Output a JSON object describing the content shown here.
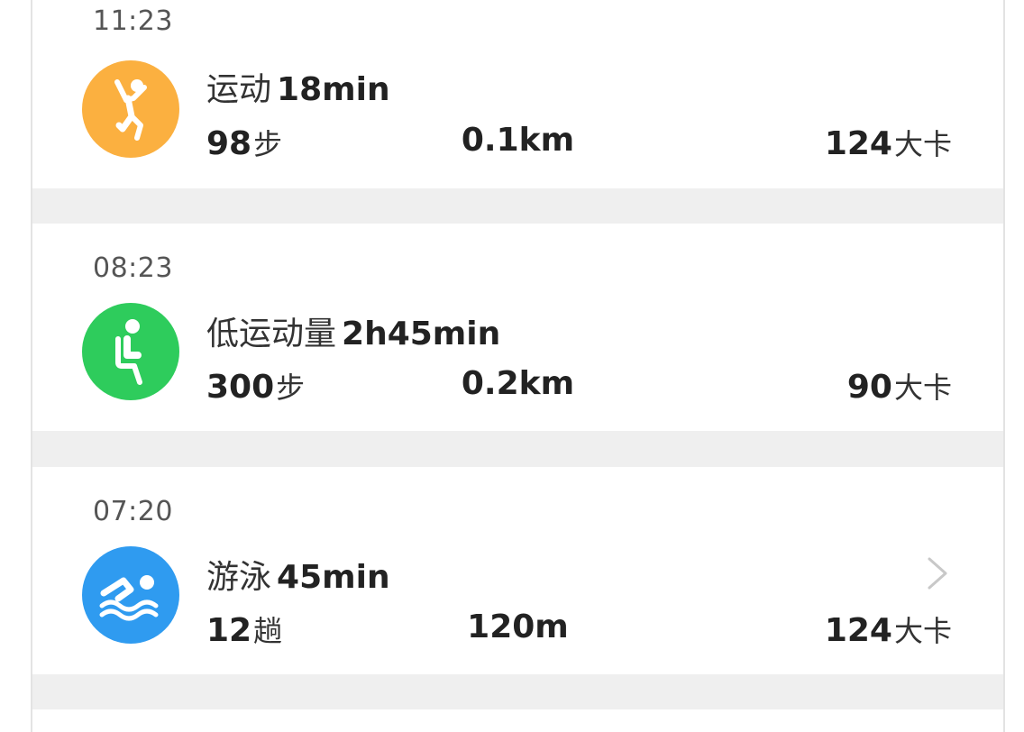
{
  "colors": {
    "exercise": "#fbb040",
    "low_activity": "#2ecc5c",
    "swim": "#2f9bf0"
  },
  "records": [
    {
      "time": "11:23",
      "icon": "person-jumping-icon",
      "activity": "运动",
      "duration": "18min",
      "steps_value": "98",
      "steps_unit": "步",
      "distance": "0.1km",
      "calories_value": "124",
      "calories_unit": "大卡"
    },
    {
      "time": "08:23",
      "icon": "person-sitting-icon",
      "activity": "低运动量",
      "duration": "2h45min",
      "steps_value": "300",
      "steps_unit": "步",
      "distance": "0.2km",
      "calories_value": "90",
      "calories_unit": "大卡"
    },
    {
      "time": "07:20",
      "icon": "swimming-icon",
      "activity": "游泳",
      "duration": "45min",
      "steps_value": "12",
      "steps_unit": "趟",
      "distance": "120m",
      "calories_value": "124",
      "calories_unit": "大卡"
    }
  ]
}
